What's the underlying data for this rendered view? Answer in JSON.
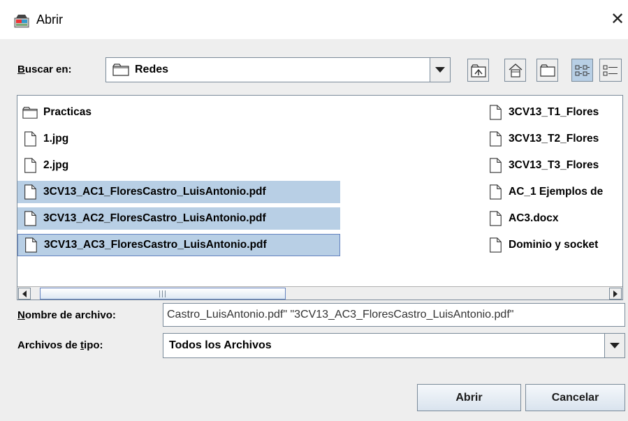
{
  "window": {
    "title": "Abrir",
    "close_glyph": "✕"
  },
  "lookin": {
    "label_key": "B",
    "label_rest": "uscar en:",
    "value": "Redes"
  },
  "toolbar": {
    "buttons": [
      {
        "icon": "up-folder-icon"
      },
      {
        "icon": "home-icon"
      },
      {
        "icon": "new-folder-icon"
      },
      {
        "icon": "list-view-icon",
        "pressed": true
      },
      {
        "icon": "details-view-icon"
      }
    ]
  },
  "files": {
    "column1": [
      {
        "name": "Practicas",
        "type": "folder"
      },
      {
        "name": "1.jpg",
        "type": "file"
      },
      {
        "name": "2.jpg",
        "type": "file"
      },
      {
        "name": "3CV13_AC1_FloresCastro_LuisAntonio.pdf",
        "type": "file",
        "selected": true
      },
      {
        "name": "3CV13_AC2_FloresCastro_LuisAntonio.pdf",
        "type": "file",
        "selected": true
      },
      {
        "name": "3CV13_AC3_FloresCastro_LuisAntonio.pdf",
        "type": "file",
        "selected": true,
        "focused": true
      }
    ],
    "column2": [
      {
        "name": "3CV13_T1_Flores",
        "type": "file"
      },
      {
        "name": "3CV13_T2_Flores",
        "type": "file"
      },
      {
        "name": "3CV13_T3_Flores",
        "type": "file"
      },
      {
        "name": "AC_1 Ejemplos de",
        "type": "file"
      },
      {
        "name": "AC3.docx",
        "type": "file"
      },
      {
        "name": "Dominio y socket",
        "type": "file"
      }
    ]
  },
  "filename": {
    "label_key": "N",
    "label_rest": "ombre de archivo:",
    "value": "Castro_LuisAntonio.pdf\" \"3CV13_AC3_FloresCastro_LuisAntonio.pdf\""
  },
  "filetype": {
    "label_pre": "Archivos de ",
    "label_key": "t",
    "label_rest": "ipo:",
    "value": "Todos los Archivos"
  },
  "actions": {
    "open": "Abrir",
    "cancel": "Cancelar"
  }
}
